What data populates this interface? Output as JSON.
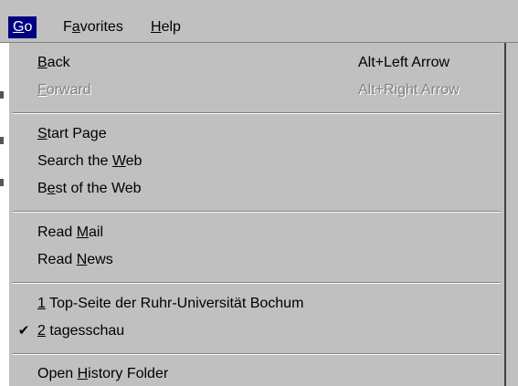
{
  "menubar": {
    "items": [
      {
        "pre": "",
        "accel": "G",
        "post": "o",
        "active": true
      },
      {
        "pre": "F",
        "accel": "a",
        "post": "vorites",
        "active": false
      },
      {
        "pre": "",
        "accel": "H",
        "post": "elp",
        "active": false
      }
    ]
  },
  "menu": {
    "back": {
      "pre": "",
      "accel": "B",
      "post": "ack",
      "shortcut": "Alt+Left Arrow"
    },
    "forward": {
      "pre": "",
      "accel": "F",
      "post": "orward",
      "shortcut": "Alt+Right Arrow",
      "disabled": true
    },
    "start_page": {
      "pre": "",
      "accel": "S",
      "post": "tart Page"
    },
    "search_web": {
      "pre": "Search the ",
      "accel": "W",
      "post": "eb"
    },
    "best_web": {
      "pre": "B",
      "accel": "e",
      "post": "st of the Web"
    },
    "read_mail": {
      "pre": "Read ",
      "accel": "M",
      "post": "ail"
    },
    "read_news": {
      "pre": "Read ",
      "accel": "N",
      "post": "ews"
    },
    "history_1": {
      "pre": "",
      "accel": "1",
      "post": " Top-Seite der Ruhr-Universität Bochum"
    },
    "history_2": {
      "pre": "",
      "accel": "2",
      "post": " tagesschau",
      "checked": true,
      "check_glyph": "✔"
    },
    "open_history": {
      "pre": "Open ",
      "accel": "H",
      "post": "istory Folder"
    }
  }
}
